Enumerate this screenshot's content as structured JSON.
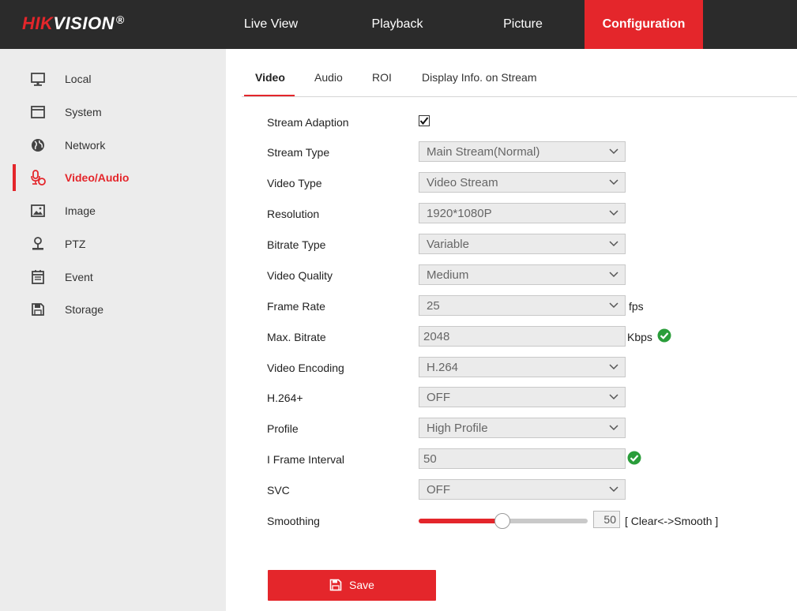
{
  "brand": {
    "prefix": "HIK",
    "suffix": "VISION",
    "reg": "®"
  },
  "nav": {
    "items": [
      {
        "label": "Live View"
      },
      {
        "label": "Playback"
      },
      {
        "label": "Picture"
      },
      {
        "label": "Configuration",
        "active": true
      }
    ]
  },
  "sidebar": {
    "items": [
      {
        "label": "Local",
        "icon": "monitor-icon"
      },
      {
        "label": "System",
        "icon": "window-icon"
      },
      {
        "label": "Network",
        "icon": "globe-icon"
      },
      {
        "label": "Video/Audio",
        "icon": "microphone-icon",
        "active": true
      },
      {
        "label": "Image",
        "icon": "image-icon"
      },
      {
        "label": "PTZ",
        "icon": "person-icon"
      },
      {
        "label": "Event",
        "icon": "calendar-icon"
      },
      {
        "label": "Storage",
        "icon": "floppy-icon"
      }
    ]
  },
  "tabs": [
    {
      "label": "Video",
      "active": true
    },
    {
      "label": "Audio"
    },
    {
      "label": "ROI"
    },
    {
      "label": "Display Info. on Stream"
    }
  ],
  "form": {
    "stream_adaption": {
      "label": "Stream Adaption",
      "checked": true
    },
    "stream_type": {
      "label": "Stream Type",
      "value": "Main Stream(Normal)"
    },
    "video_type": {
      "label": "Video Type",
      "value": "Video Stream"
    },
    "resolution": {
      "label": "Resolution",
      "value": "1920*1080P"
    },
    "bitrate_type": {
      "label": "Bitrate Type",
      "value": "Variable"
    },
    "video_quality": {
      "label": "Video Quality",
      "value": "Medium"
    },
    "frame_rate": {
      "label": "Frame Rate",
      "value": "25",
      "unit": "fps"
    },
    "max_bitrate": {
      "label": "Max. Bitrate",
      "value": "2048",
      "unit": "Kbps"
    },
    "video_encoding": {
      "label": "Video Encoding",
      "value": "H.264"
    },
    "h264_plus": {
      "label": "H.264+",
      "value": "OFF"
    },
    "profile": {
      "label": "Profile",
      "value": "High Profile"
    },
    "i_frame_interval": {
      "label": "I Frame Interval",
      "value": "50"
    },
    "svc": {
      "label": "SVC",
      "value": "OFF"
    },
    "smoothing": {
      "label": "Smoothing",
      "value": "50",
      "min": 1,
      "max": 100,
      "hint": "[ Clear<->Smooth ]"
    }
  },
  "save": {
    "label": "Save"
  },
  "colors": {
    "accent": "#e4262b",
    "topbar": "#2b2b2b",
    "sidebar": "#ececec",
    "ok": "#2a9d3a"
  }
}
